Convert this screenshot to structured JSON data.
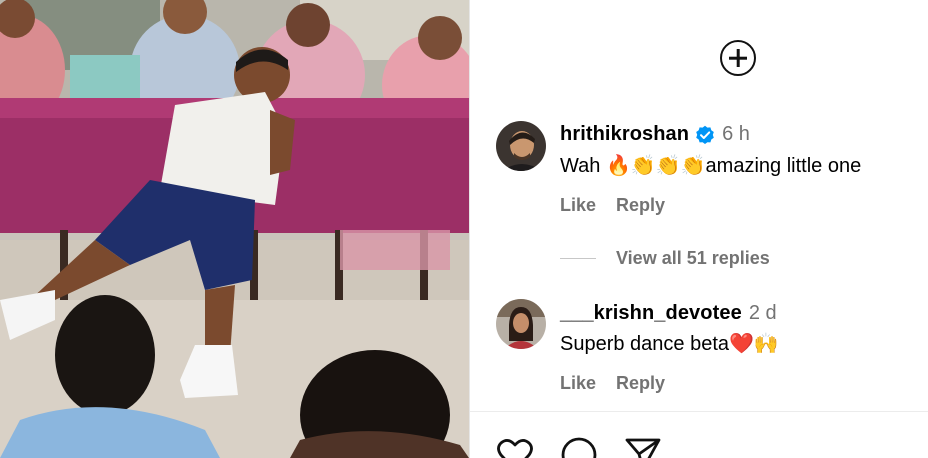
{
  "media": {
    "icons": [
      "video-frame"
    ]
  },
  "panel": {
    "add_icon": "plus-circle-icon",
    "comments": [
      {
        "username": "hrithikroshan",
        "verified": true,
        "time": "6 h",
        "text": "Wah 🔥👏👏👏amazing little one",
        "like_label": "Like",
        "reply_label": "Reply"
      },
      {
        "username": "___krishn_devotee",
        "verified": false,
        "time": "2 d",
        "text": "Superb dance beta❤️🙌",
        "like_label": "Like",
        "reply_label": "Reply"
      }
    ],
    "view_replies": "View all 51 replies",
    "action_bar": [
      "heart-icon",
      "comment-icon",
      "share-icon"
    ]
  },
  "colors": {
    "secondary_text": "#737373",
    "verified_blue": "#0095f6",
    "border": "#e6e6e6"
  }
}
